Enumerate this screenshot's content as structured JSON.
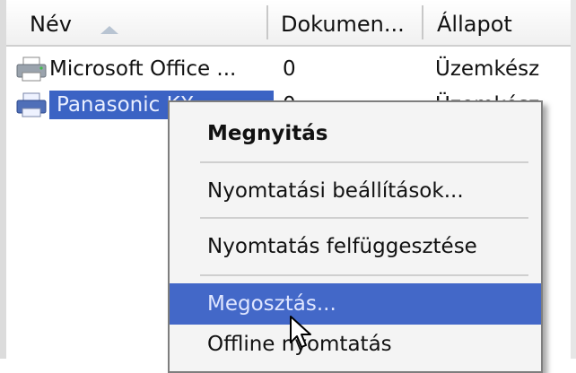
{
  "columns": [
    {
      "label": "Név"
    },
    {
      "label": "Dokumen..."
    },
    {
      "label": "Állapot"
    }
  ],
  "printers": [
    {
      "name": "Microsoft Office ...",
      "docs": "0",
      "status": "Üzemkész",
      "selected": false
    },
    {
      "name": "Panasonic KX-...",
      "docs": "0",
      "status": "Üzemkész",
      "selected": true
    }
  ],
  "context_menu": {
    "items": [
      {
        "label": "Megnyitás",
        "bold": true
      },
      {
        "label": "Nyomtatási beállítások..."
      },
      {
        "label": "Nyomtatás felfüggesztése"
      },
      {
        "label": "Megosztás...",
        "highlighted": true
      },
      {
        "label": "Offline nyomtatás"
      }
    ]
  },
  "colors": {
    "selection": "#3b63c4",
    "menu_highlight": "#4368c8"
  }
}
